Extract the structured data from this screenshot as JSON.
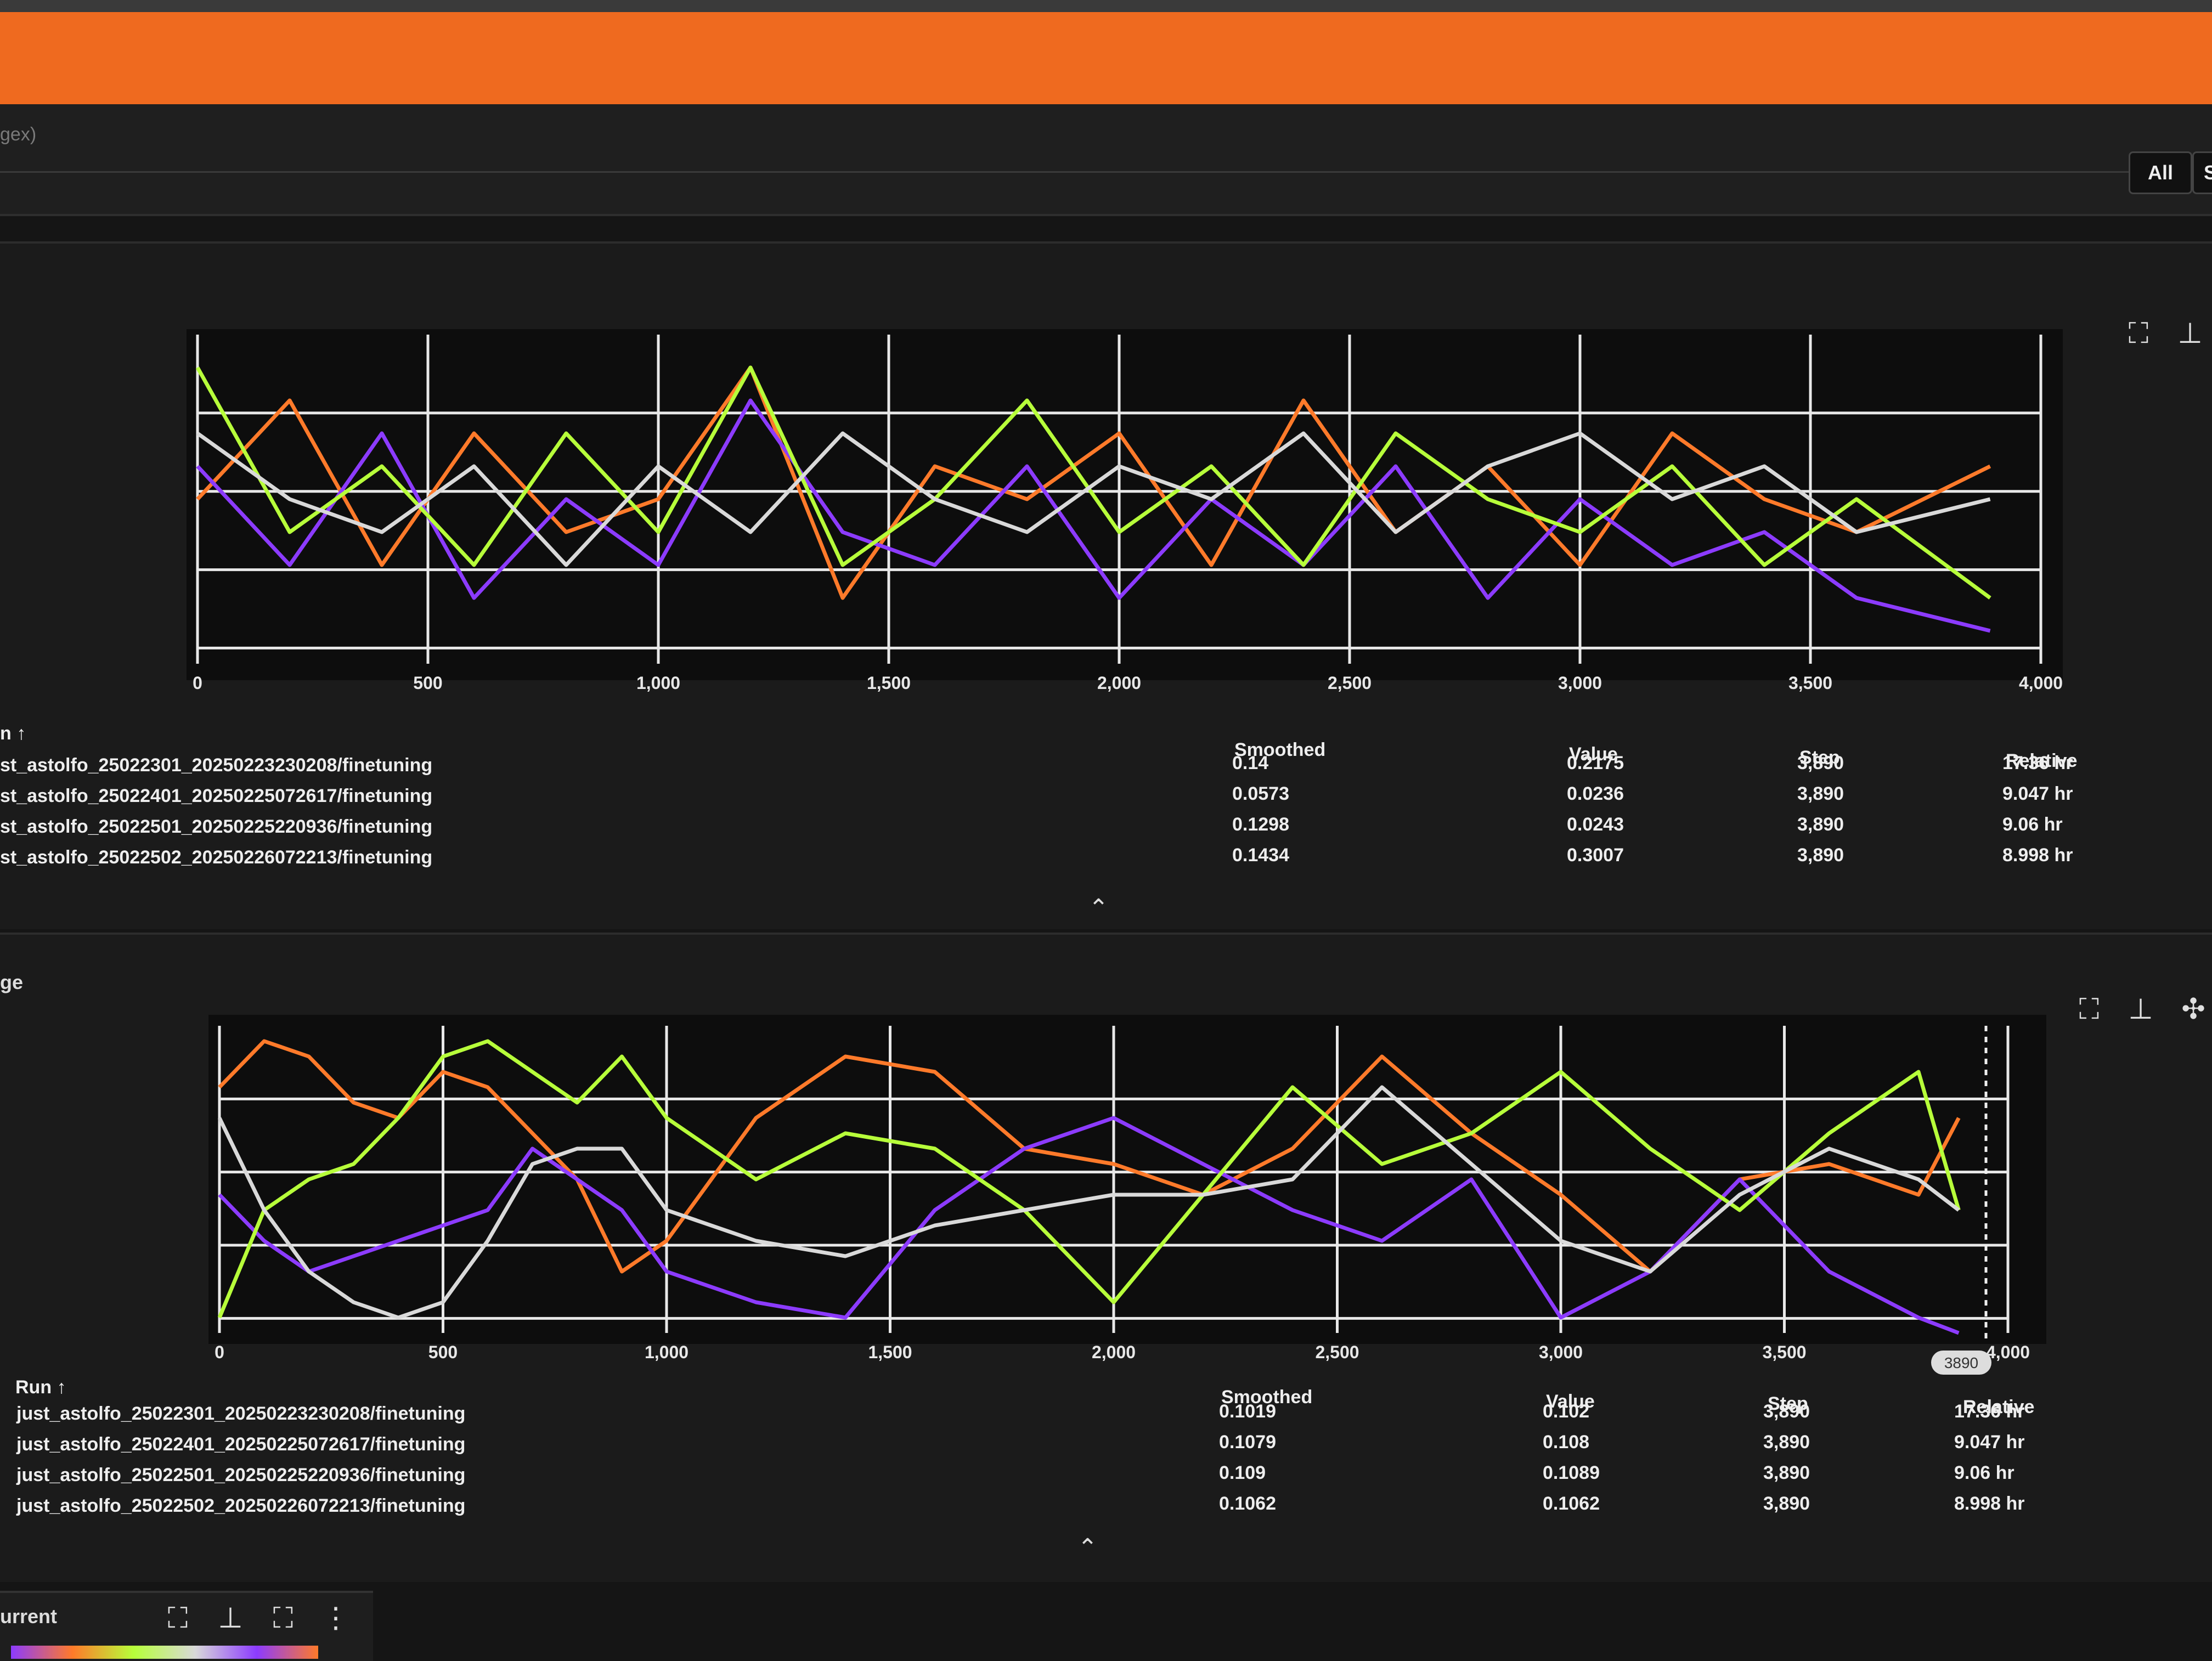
{
  "header": {
    "filter_placeholder_fragment": "gex)"
  },
  "toolbar": {
    "all_label": "All",
    "single_label": "S"
  },
  "charts_meta": {
    "chart1": {
      "title": ""
    },
    "chart2": {
      "title": "ge"
    }
  },
  "table_headers": {
    "run": "Run ↑",
    "smoothed": "Smoothed",
    "value": "Value",
    "step": "Step",
    "relative": "Relative"
  },
  "table1": [
    {
      "run": "st_astolfo_25022301_20250223230208/finetuning",
      "smoothed": "0.14",
      "value": "0.2175",
      "step": "3,890",
      "relative": "17.36 hr"
    },
    {
      "run": "st_astolfo_25022401_20250225072617/finetuning",
      "smoothed": "0.0573",
      "value": "0.0236",
      "step": "3,890",
      "relative": "9.047 hr"
    },
    {
      "run": "st_astolfo_25022501_20250225220936/finetuning",
      "smoothed": "0.1298",
      "value": "0.0243",
      "step": "3,890",
      "relative": "9.06 hr"
    },
    {
      "run": "st_astolfo_25022502_20250226072213/finetuning",
      "smoothed": "0.1434",
      "value": "0.3007",
      "step": "3,890",
      "relative": "8.998 hr"
    }
  ],
  "table2": [
    {
      "run": "just_astolfo_25022301_20250223230208/finetuning",
      "smoothed": "0.1019",
      "value": "0.102",
      "step": "3,890",
      "relative": "17.36 hr"
    },
    {
      "run": "just_astolfo_25022401_20250225072617/finetuning",
      "smoothed": "0.1079",
      "value": "0.108",
      "step": "3,890",
      "relative": "9.047 hr"
    },
    {
      "run": "just_astolfo_25022501_20250225220936/finetuning",
      "smoothed": "0.109",
      "value": "0.1089",
      "step": "3,890",
      "relative": "9.06 hr"
    },
    {
      "run": "just_astolfo_25022502_20250226072213/finetuning",
      "smoothed": "0.1062",
      "value": "0.1062",
      "step": "3,890",
      "relative": "8.998 hr"
    }
  ],
  "table1_run_header": "n ↑",
  "hover_step_badge": "3890",
  "bottom_card_title": "urrent",
  "colors": {
    "orange": "#ff7a2a",
    "purple": "#8c3bff",
    "lime": "#b7ff3a",
    "white": "#d9d9d9",
    "accent": "#ef6a1f"
  },
  "chart_data": [
    {
      "type": "line",
      "title": "",
      "x_ticks": [
        "0",
        "500",
        "1,000",
        "1,500",
        "2,000",
        "2,500",
        "3,000",
        "3,500",
        "4,000"
      ],
      "xlim": [
        0,
        4000
      ],
      "ylim": [
        0,
        1
      ],
      "grid": true,
      "series": [
        {
          "name": "st_astolfo_25022301_20250223230208/finetuning",
          "color": "#ff7a2a",
          "x": [
            0,
            200,
            400,
            600,
            800,
            1000,
            1200,
            1400,
            1600,
            1800,
            2000,
            2200,
            2400,
            2600,
            2800,
            3000,
            3200,
            3400,
            3600,
            3890
          ],
          "y": [
            0.5,
            0.8,
            0.3,
            0.7,
            0.4,
            0.5,
            0.9,
            0.2,
            0.6,
            0.5,
            0.7,
            0.3,
            0.8,
            0.4,
            0.6,
            0.3,
            0.7,
            0.5,
            0.4,
            0.6
          ]
        },
        {
          "name": "st_astolfo_25022401_20250225072617/finetuning",
          "color": "#8c3bff",
          "x": [
            0,
            200,
            400,
            600,
            800,
            1000,
            1200,
            1400,
            1600,
            1800,
            2000,
            2200,
            2400,
            2600,
            2800,
            3000,
            3200,
            3400,
            3600,
            3890
          ],
          "y": [
            0.6,
            0.3,
            0.7,
            0.2,
            0.5,
            0.3,
            0.8,
            0.4,
            0.3,
            0.6,
            0.2,
            0.5,
            0.3,
            0.6,
            0.2,
            0.5,
            0.3,
            0.4,
            0.2,
            0.1
          ]
        },
        {
          "name": "st_astolfo_25022501_20250225220936/finetuning",
          "color": "#b7ff3a",
          "x": [
            0,
            200,
            400,
            600,
            800,
            1000,
            1200,
            1400,
            1600,
            1800,
            2000,
            2200,
            2400,
            2600,
            2800,
            3000,
            3200,
            3400,
            3600,
            3890
          ],
          "y": [
            0.9,
            0.4,
            0.6,
            0.3,
            0.7,
            0.4,
            0.9,
            0.3,
            0.5,
            0.8,
            0.4,
            0.6,
            0.3,
            0.7,
            0.5,
            0.4,
            0.6,
            0.3,
            0.5,
            0.2
          ]
        },
        {
          "name": "st_astolfo_25022502_20250226072213/finetuning",
          "color": "#d9d9d9",
          "x": [
            0,
            200,
            400,
            600,
            800,
            1000,
            1200,
            1400,
            1600,
            1800,
            2000,
            2200,
            2400,
            2600,
            2800,
            3000,
            3200,
            3400,
            3600,
            3890
          ],
          "y": [
            0.7,
            0.5,
            0.4,
            0.6,
            0.3,
            0.6,
            0.4,
            0.7,
            0.5,
            0.4,
            0.6,
            0.5,
            0.7,
            0.4,
            0.6,
            0.7,
            0.5,
            0.6,
            0.4,
            0.5
          ]
        }
      ]
    },
    {
      "type": "line",
      "title": "ge",
      "x_ticks": [
        "0",
        "500",
        "1,000",
        "1,500",
        "2,000",
        "2,500",
        "3,000",
        "3,500",
        "4,000"
      ],
      "xlim": [
        0,
        4000
      ],
      "ylim": [
        0,
        1
      ],
      "grid": true,
      "series": [
        {
          "name": "just_astolfo_25022301_20250223230208/finetuning",
          "color": "#ff7a2a",
          "x": [
            0,
            100,
            200,
            300,
            400,
            500,
            600,
            700,
            800,
            900,
            1000,
            1200,
            1400,
            1600,
            1800,
            2000,
            2200,
            2400,
            2600,
            2800,
            3000,
            3200,
            3400,
            3600,
            3800,
            3890
          ],
          "y": [
            0.8,
            0.95,
            0.9,
            0.75,
            0.7,
            0.85,
            0.8,
            0.65,
            0.5,
            0.2,
            0.3,
            0.7,
            0.9,
            0.85,
            0.6,
            0.55,
            0.45,
            0.6,
            0.9,
            0.65,
            0.45,
            0.2,
            0.5,
            0.55,
            0.45,
            0.7
          ]
        },
        {
          "name": "just_astolfo_25022401_20250225072617/finetuning",
          "color": "#8c3bff",
          "x": [
            0,
            100,
            200,
            300,
            400,
            500,
            600,
            700,
            800,
            900,
            1000,
            1200,
            1400,
            1600,
            1800,
            2000,
            2200,
            2400,
            2600,
            2800,
            3000,
            3200,
            3400,
            3600,
            3800,
            3890
          ],
          "y": [
            0.45,
            0.3,
            0.2,
            0.25,
            0.3,
            0.35,
            0.4,
            0.6,
            0.5,
            0.4,
            0.2,
            0.1,
            0.05,
            0.4,
            0.6,
            0.7,
            0.55,
            0.4,
            0.3,
            0.5,
            0.05,
            0.2,
            0.5,
            0.2,
            0.05,
            0.0
          ]
        },
        {
          "name": "just_astolfo_25022501_20250225220936/finetuning",
          "color": "#b7ff3a",
          "x": [
            0,
            100,
            200,
            300,
            400,
            500,
            600,
            700,
            800,
            900,
            1000,
            1200,
            1400,
            1600,
            1800,
            2000,
            2200,
            2400,
            2600,
            2800,
            3000,
            3200,
            3400,
            3600,
            3800,
            3890
          ],
          "y": [
            0.05,
            0.4,
            0.5,
            0.55,
            0.7,
            0.9,
            0.95,
            0.85,
            0.75,
            0.9,
            0.7,
            0.5,
            0.65,
            0.6,
            0.4,
            0.1,
            0.45,
            0.8,
            0.55,
            0.65,
            0.85,
            0.6,
            0.4,
            0.65,
            0.85,
            0.4
          ]
        },
        {
          "name": "just_astolfo_25022502_20250226072213/finetuning",
          "color": "#d9d9d9",
          "x": [
            0,
            100,
            200,
            300,
            400,
            500,
            600,
            700,
            800,
            900,
            1000,
            1200,
            1400,
            1600,
            1800,
            2000,
            2200,
            2400,
            2600,
            2800,
            3000,
            3200,
            3400,
            3600,
            3800,
            3890
          ],
          "y": [
            0.7,
            0.4,
            0.2,
            0.1,
            0.05,
            0.1,
            0.3,
            0.55,
            0.6,
            0.6,
            0.4,
            0.3,
            0.25,
            0.35,
            0.4,
            0.45,
            0.45,
            0.5,
            0.8,
            0.55,
            0.3,
            0.2,
            0.45,
            0.6,
            0.5,
            0.4
          ]
        }
      ]
    }
  ]
}
